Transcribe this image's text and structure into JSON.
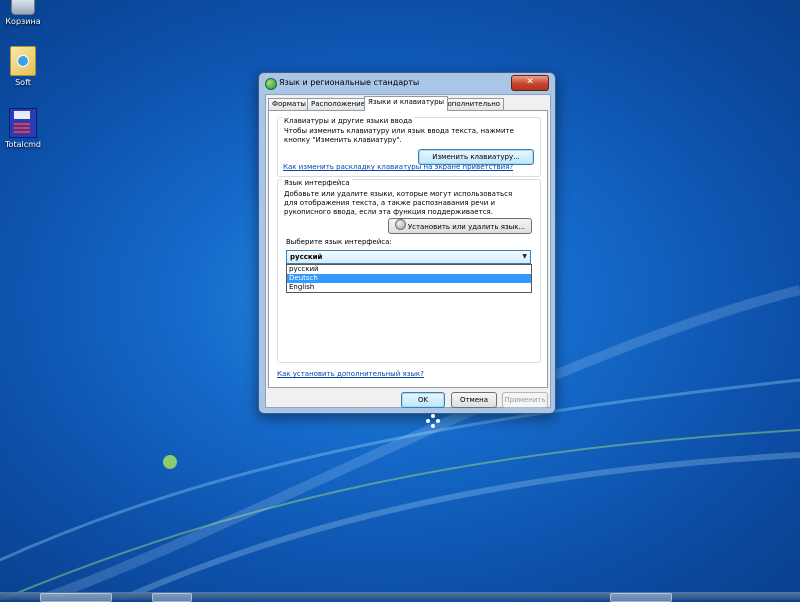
{
  "desktop": {
    "icons": [
      {
        "label": "Корзина",
        "icon": "recycle-bin-icon"
      },
      {
        "label": "Soft",
        "icon": "folder-icon"
      },
      {
        "label": "Totalcmd",
        "icon": "total-commander-icon"
      }
    ]
  },
  "dialog": {
    "title": "Язык и региональные стандарты",
    "close_label": "✕",
    "tabs": [
      {
        "label": "Форматы",
        "active": false
      },
      {
        "label": "Расположение",
        "active": false
      },
      {
        "label": "Языки и клавиатуры",
        "active": true
      },
      {
        "label": "Дополнительно",
        "active": false
      }
    ],
    "keyboards_group": {
      "title": "Клавиатуры и другие языки ввода",
      "description": "Чтобы изменить клавиатуру или язык ввода текста, нажмите кнопку \"Изменить клавиатуру\".",
      "button": "Изменить клавиатуру...",
      "link": "Как изменить раскладку клавиатуры на экране приветствия?"
    },
    "ui_language_group": {
      "title": "Язык интерфейса",
      "description": "Добавьте или удалите языки, которые могут использоваться для отображения текста, а также распознавания речи и рукописного ввода, если эта функция поддерживается.",
      "install_button": "Установить или удалить язык...",
      "select_label": "Выберите язык интерфейса:",
      "selected_value": "русский",
      "options": [
        {
          "label": "русский",
          "highlighted": false
        },
        {
          "label": "Deutsch",
          "highlighted": true
        },
        {
          "label": "English",
          "highlighted": false
        }
      ]
    },
    "bottom_link": "Как установить дополнительный язык?",
    "buttons": {
      "ok": "OK",
      "cancel": "Отмена",
      "apply": "Применить"
    }
  }
}
